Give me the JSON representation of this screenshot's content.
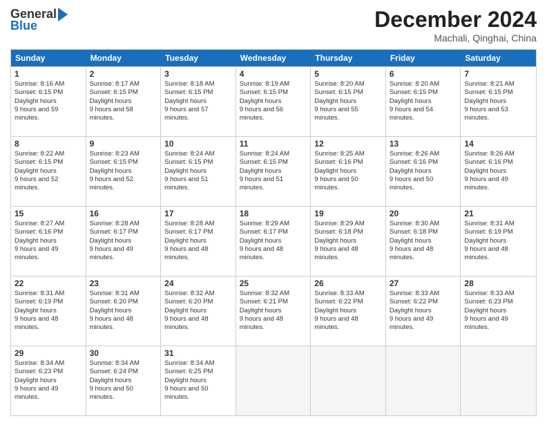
{
  "logo": {
    "general": "General",
    "blue": "Blue"
  },
  "title": "December 2024",
  "location": "Machali, Qinghai, China",
  "days": [
    "Sunday",
    "Monday",
    "Tuesday",
    "Wednesday",
    "Thursday",
    "Friday",
    "Saturday"
  ],
  "weeks": [
    [
      {
        "day": "1",
        "sunrise": "8:16 AM",
        "sunset": "6:15 PM",
        "daylight": "9 hours and 59 minutes."
      },
      {
        "day": "2",
        "sunrise": "8:17 AM",
        "sunset": "6:15 PM",
        "daylight": "9 hours and 58 minutes."
      },
      {
        "day": "3",
        "sunrise": "8:18 AM",
        "sunset": "6:15 PM",
        "daylight": "9 hours and 57 minutes."
      },
      {
        "day": "4",
        "sunrise": "8:19 AM",
        "sunset": "6:15 PM",
        "daylight": "9 hours and 56 minutes."
      },
      {
        "day": "5",
        "sunrise": "8:20 AM",
        "sunset": "6:15 PM",
        "daylight": "9 hours and 55 minutes."
      },
      {
        "day": "6",
        "sunrise": "8:20 AM",
        "sunset": "6:15 PM",
        "daylight": "9 hours and 54 minutes."
      },
      {
        "day": "7",
        "sunrise": "8:21 AM",
        "sunset": "6:15 PM",
        "daylight": "9 hours and 53 minutes."
      }
    ],
    [
      {
        "day": "8",
        "sunrise": "8:22 AM",
        "sunset": "6:15 PM",
        "daylight": "9 hours and 52 minutes."
      },
      {
        "day": "9",
        "sunrise": "8:23 AM",
        "sunset": "6:15 PM",
        "daylight": "9 hours and 52 minutes."
      },
      {
        "day": "10",
        "sunrise": "8:24 AM",
        "sunset": "6:15 PM",
        "daylight": "9 hours and 51 minutes."
      },
      {
        "day": "11",
        "sunrise": "8:24 AM",
        "sunset": "6:15 PM",
        "daylight": "9 hours and 51 minutes."
      },
      {
        "day": "12",
        "sunrise": "8:25 AM",
        "sunset": "6:16 PM",
        "daylight": "9 hours and 50 minutes."
      },
      {
        "day": "13",
        "sunrise": "8:26 AM",
        "sunset": "6:16 PM",
        "daylight": "9 hours and 50 minutes."
      },
      {
        "day": "14",
        "sunrise": "8:26 AM",
        "sunset": "6:16 PM",
        "daylight": "9 hours and 49 minutes."
      }
    ],
    [
      {
        "day": "15",
        "sunrise": "8:27 AM",
        "sunset": "6:16 PM",
        "daylight": "9 hours and 49 minutes."
      },
      {
        "day": "16",
        "sunrise": "8:28 AM",
        "sunset": "6:17 PM",
        "daylight": "9 hours and 49 minutes."
      },
      {
        "day": "17",
        "sunrise": "8:28 AM",
        "sunset": "6:17 PM",
        "daylight": "9 hours and 48 minutes."
      },
      {
        "day": "18",
        "sunrise": "8:29 AM",
        "sunset": "6:17 PM",
        "daylight": "9 hours and 48 minutes."
      },
      {
        "day": "19",
        "sunrise": "8:29 AM",
        "sunset": "6:18 PM",
        "daylight": "9 hours and 48 minutes."
      },
      {
        "day": "20",
        "sunrise": "8:30 AM",
        "sunset": "6:18 PM",
        "daylight": "9 hours and 48 minutes."
      },
      {
        "day": "21",
        "sunrise": "8:31 AM",
        "sunset": "6:19 PM",
        "daylight": "9 hours and 48 minutes."
      }
    ],
    [
      {
        "day": "22",
        "sunrise": "8:31 AM",
        "sunset": "6:19 PM",
        "daylight": "9 hours and 48 minutes."
      },
      {
        "day": "23",
        "sunrise": "8:31 AM",
        "sunset": "6:20 PM",
        "daylight": "9 hours and 48 minutes."
      },
      {
        "day": "24",
        "sunrise": "8:32 AM",
        "sunset": "6:20 PM",
        "daylight": "9 hours and 48 minutes."
      },
      {
        "day": "25",
        "sunrise": "8:32 AM",
        "sunset": "6:21 PM",
        "daylight": "9 hours and 48 minutes."
      },
      {
        "day": "26",
        "sunrise": "8:33 AM",
        "sunset": "6:22 PM",
        "daylight": "9 hours and 48 minutes."
      },
      {
        "day": "27",
        "sunrise": "8:33 AM",
        "sunset": "6:22 PM",
        "daylight": "9 hours and 49 minutes."
      },
      {
        "day": "28",
        "sunrise": "8:33 AM",
        "sunset": "6:23 PM",
        "daylight": "9 hours and 49 minutes."
      }
    ],
    [
      {
        "day": "29",
        "sunrise": "8:34 AM",
        "sunset": "6:23 PM",
        "daylight": "9 hours and 49 minutes."
      },
      {
        "day": "30",
        "sunrise": "8:34 AM",
        "sunset": "6:24 PM",
        "daylight": "9 hours and 50 minutes."
      },
      {
        "day": "31",
        "sunrise": "8:34 AM",
        "sunset": "6:25 PM",
        "daylight": "9 hours and 50 minutes."
      },
      null,
      null,
      null,
      null
    ]
  ],
  "labels": {
    "sunrise": "Sunrise:",
    "sunset": "Sunset:",
    "daylight": "Daylight:"
  }
}
